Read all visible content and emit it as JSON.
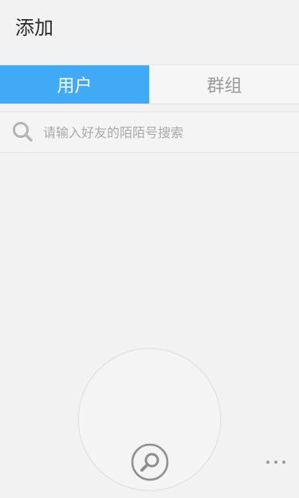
{
  "header": {
    "title": "添加"
  },
  "tabs": [
    {
      "label": "用户",
      "active": true
    },
    {
      "label": "群组",
      "active": false
    }
  ],
  "search": {
    "placeholder": "请输入好友的陌陌号搜索",
    "value": ""
  },
  "icons": {
    "search": "search-icon",
    "circle_search": "magnifier-icon",
    "more": "more-dots-icon"
  },
  "colors": {
    "accent": "#41aaf7",
    "background": "#f2f2f2",
    "inactive_text": "#9b9b9b",
    "icon_gray": "#9c9c9c"
  }
}
